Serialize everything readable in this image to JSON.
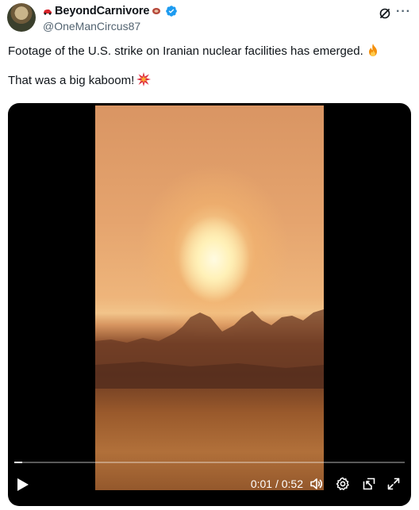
{
  "author": {
    "display_name": "BeyondCarnivore",
    "handle": "@OneManCircus87"
  },
  "tweet": {
    "line1": "Footage of the U.S. strike on Iranian nuclear facilities has emerged.",
    "line2": "That was a big kaboom!"
  },
  "video": {
    "current_time": "0:01",
    "duration": "0:52",
    "time_display": "0:01 / 0:52",
    "progress_fraction": 0.02
  },
  "icons": {
    "name_prefix": "sports-car-icon",
    "name_suffix": "meat-icon",
    "verified": "verified-badge-icon",
    "grok": "grok-icon",
    "more": "more-icon",
    "line1_emoji": "fire-emoji-icon",
    "line2_emoji": "collision-emoji-icon",
    "play": "play-icon",
    "volume": "volume-icon",
    "settings": "gear-icon",
    "pip": "picture-in-picture-icon",
    "fullscreen": "expand-icon"
  },
  "colors": {
    "verified_blue": "#1d9bf0",
    "text": "#0f1419",
    "secondary_text": "#536471"
  }
}
